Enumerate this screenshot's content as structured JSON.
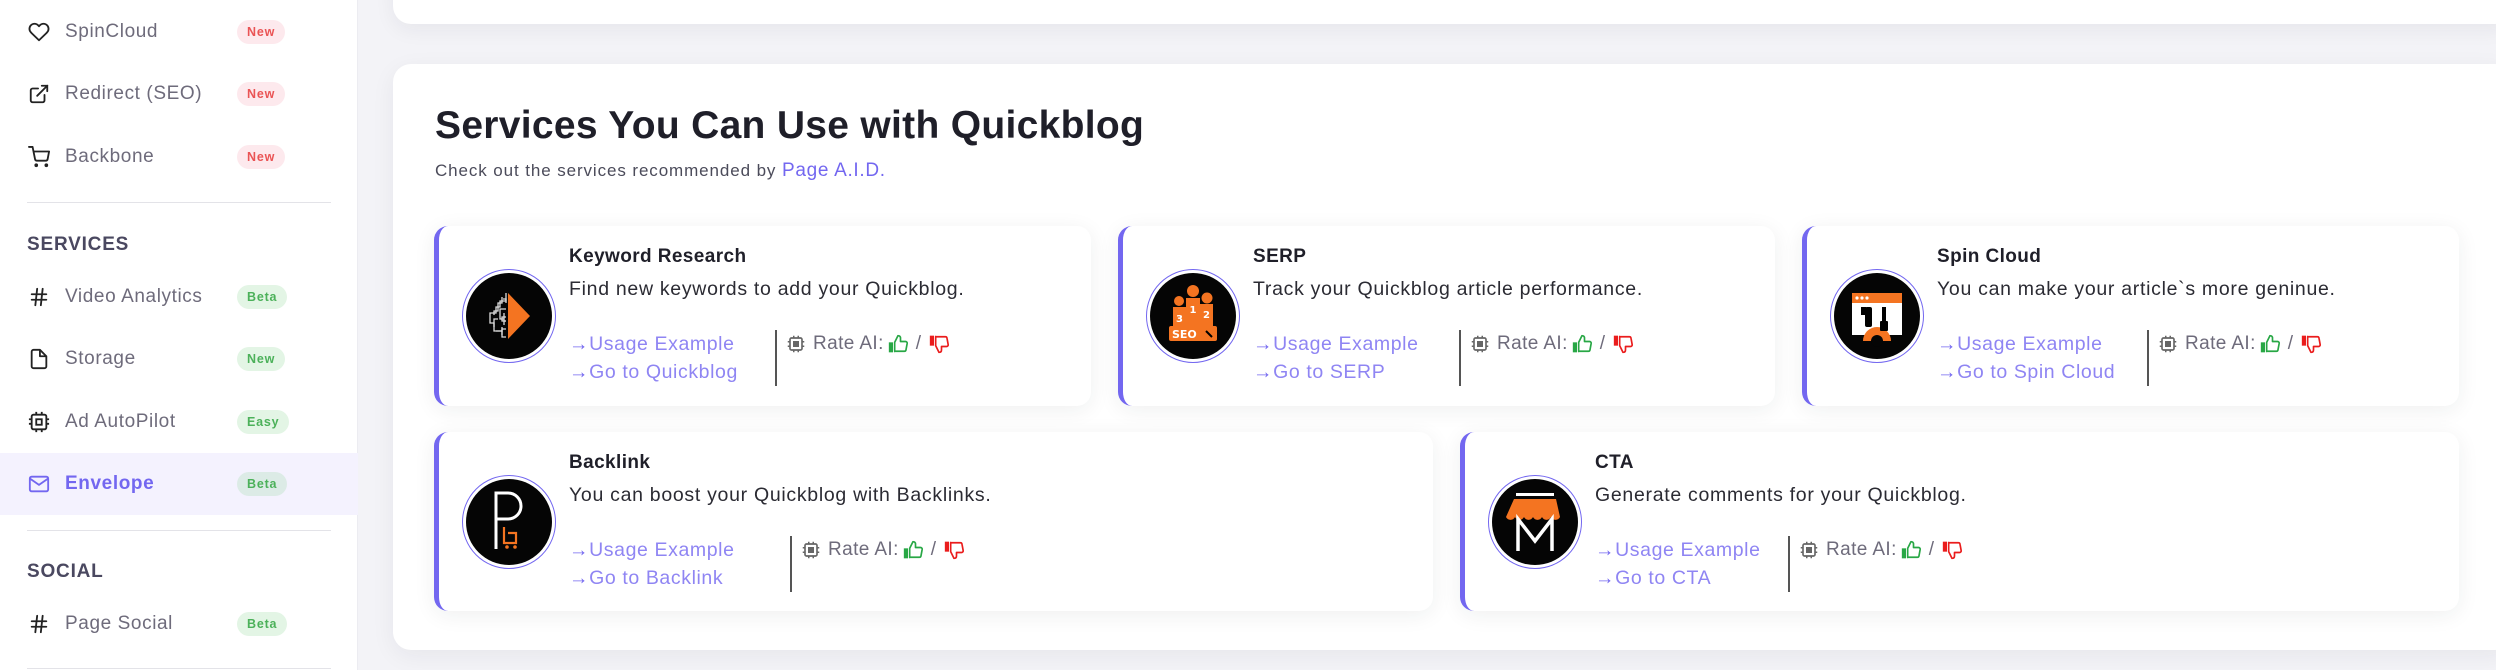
{
  "sidebar": {
    "items_top": [
      {
        "label": "SpinCloud",
        "icon": "heart-icon",
        "badge": "New",
        "badge_style": "red"
      },
      {
        "label": "Redirect (SEO)",
        "icon": "external-link-icon",
        "badge": "New",
        "badge_style": "red"
      },
      {
        "label": "Backbone",
        "icon": "shopping-cart-icon",
        "badge": "New",
        "badge_style": "red"
      }
    ],
    "services_title": "SERVICES",
    "services": [
      {
        "label": "Video Analytics",
        "icon": "hash-icon",
        "badge": "Beta",
        "badge_style": "green"
      },
      {
        "label": "Storage",
        "icon": "file-icon",
        "badge": "New",
        "badge_style": "green"
      },
      {
        "label": "Ad AutoPilot",
        "icon": "cpu-icon",
        "badge": "Easy",
        "badge_style": "green"
      },
      {
        "label": "Envelope",
        "icon": "mail-icon",
        "badge": "Beta",
        "badge_style": "green",
        "active": true
      }
    ],
    "social_title": "SOCIAL",
    "social": [
      {
        "label": "Page Social",
        "icon": "hash-icon",
        "badge": "Beta",
        "badge_style": "green"
      }
    ]
  },
  "main": {
    "title": "Services You Can Use with Quickblog",
    "subtitle_prefix": "Check out the services recommended by ",
    "subtitle_brand": "Page A.I.D.",
    "rate_label": "Rate AI:",
    "rate_separator": "/",
    "link_arrow": "→",
    "services": [
      {
        "name": "Keyword Research",
        "description": "Find new keywords to add your Quickblog.",
        "usage_link": "Usage Example",
        "go_link": "Go to Quickblog",
        "logo": "keyword-research-logo"
      },
      {
        "name": "SERP",
        "description": "Track your Quickblog article performance.",
        "usage_link": "Usage Example",
        "go_link": "Go to SERP",
        "logo": "serp-podium-logo"
      },
      {
        "name": "Spin Cloud",
        "description": "You can make your article`s more geninue.",
        "usage_link": "Usage Example",
        "go_link": "Go to Spin Cloud",
        "logo": "spin-cloud-tools-logo"
      },
      {
        "name": "Backlink",
        "description": "You can boost your Quickblog with Backlinks.",
        "usage_link": "Usage Example",
        "go_link": "Go to Backlink",
        "logo": "backlink-p-logo"
      },
      {
        "name": "CTA",
        "description": "Generate comments for your Quickblog.",
        "usage_link": "Usage Example",
        "go_link": "Go to CTA",
        "logo": "cta-store-logo"
      }
    ]
  },
  "colors": {
    "accent": "#7367f0",
    "link": "#8f85f3",
    "badge_red_text": "#ea5455",
    "badge_green_text": "#4cb15a",
    "logo_orange": "#f47421",
    "thumb_up": "#28a745",
    "thumb_down": "#ea1c1c"
  }
}
